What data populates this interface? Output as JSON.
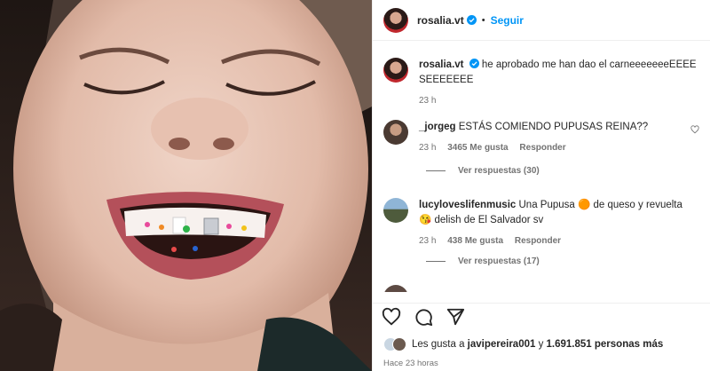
{
  "post": {
    "username": "rosalia.vt",
    "follow_label": "Seguir",
    "dot": "•",
    "caption_user": "rosalia.vt",
    "caption_text": "he aprobado me han dao el carneeeeeeeEEEE SEEEEEEE",
    "caption_time": "23 h"
  },
  "comments": [
    {
      "user": "_jorgeg",
      "text": "ESTÁS COMIENDO PUPUSAS REINA??",
      "time": "23 h",
      "likes": "3465 Me gusta",
      "reply": "Responder",
      "view_replies": "Ver respuestas (30)"
    },
    {
      "user": "lucyloveslifenmusic",
      "text": "Una Pupusa 🟠 de queso y revuelta 😘 delish de El Salvador sv",
      "time": "23 h",
      "likes": "438 Me gusta",
      "reply": "Responder",
      "view_replies": "Ver respuestas (17)"
    }
  ],
  "likes": {
    "prefix": "Les gusta a ",
    "user": "javipereira001",
    "middle": " y ",
    "count": "1.691.851 personas más"
  },
  "timestamp": "Hace 23 horas",
  "colors": {
    "accent": "#0095f6",
    "muted": "#737373"
  }
}
